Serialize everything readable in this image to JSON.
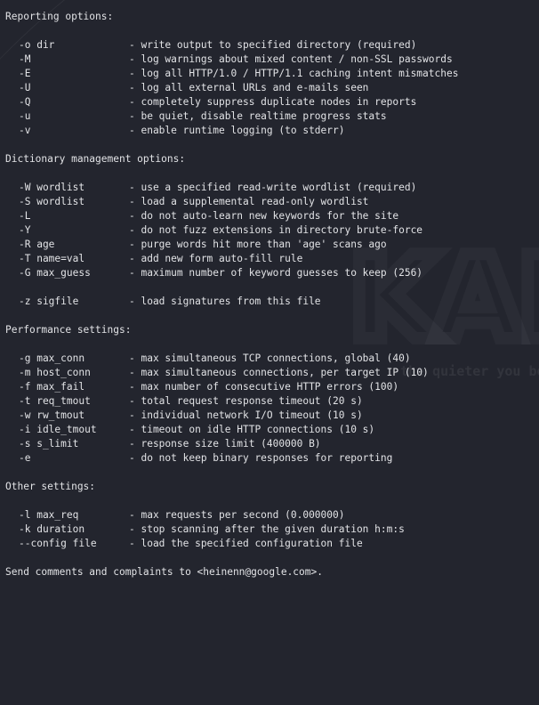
{
  "watermark": {
    "text": "KALI",
    "tagline": "the quieter you become"
  },
  "sections": [
    {
      "title": "Reporting options:",
      "options": [
        {
          "flag": "-o dir",
          "desc": "- write output to specified directory (required)"
        },
        {
          "flag": "-M",
          "desc": "- log warnings about mixed content / non-SSL passwords"
        },
        {
          "flag": "-E",
          "desc": "- log all HTTP/1.0 / HTTP/1.1 caching intent mismatches"
        },
        {
          "flag": "-U",
          "desc": "- log all external URLs and e-mails seen"
        },
        {
          "flag": "-Q",
          "desc": "- completely suppress duplicate nodes in reports"
        },
        {
          "flag": "-u",
          "desc": "- be quiet, disable realtime progress stats"
        },
        {
          "flag": "-v",
          "desc": "- enable runtime logging (to stderr)"
        }
      ]
    },
    {
      "title": "Dictionary management options:",
      "options": [
        {
          "flag": "-W wordlist",
          "desc": "- use a specified read-write wordlist (required)"
        },
        {
          "flag": "-S wordlist",
          "desc": "- load a supplemental read-only wordlist"
        },
        {
          "flag": "-L",
          "desc": "- do not auto-learn new keywords for the site"
        },
        {
          "flag": "-Y",
          "desc": "- do not fuzz extensions in directory brute-force"
        },
        {
          "flag": "-R age",
          "desc": "- purge words hit more than 'age' scans ago"
        },
        {
          "flag": "-T name=val",
          "desc": "- add new form auto-fill rule"
        },
        {
          "flag": "-G max_guess",
          "desc": "- maximum number of keyword guesses to keep (256)"
        },
        {
          "flag": "",
          "desc": ""
        },
        {
          "flag": "-z sigfile",
          "desc": "- load signatures from this file"
        }
      ]
    },
    {
      "title": "Performance settings:",
      "options": [
        {
          "flag": "-g max_conn",
          "desc": "- max simultaneous TCP connections, global (40)"
        },
        {
          "flag": "-m host_conn",
          "desc": "- max simultaneous connections, per target IP (10)"
        },
        {
          "flag": "-f max_fail",
          "desc": "- max number of consecutive HTTP errors (100)"
        },
        {
          "flag": "-t req_tmout",
          "desc": "- total request response timeout (20 s)"
        },
        {
          "flag": "-w rw_tmout",
          "desc": "- individual network I/O timeout (10 s)"
        },
        {
          "flag": "-i idle_tmout",
          "desc": "- timeout on idle HTTP connections (10 s)"
        },
        {
          "flag": "-s s_limit",
          "desc": "- response size limit (400000 B)"
        },
        {
          "flag": "-e",
          "desc": "- do not keep binary responses for reporting"
        }
      ]
    },
    {
      "title": "Other settings:",
      "options": [
        {
          "flag": "-l max_req",
          "desc": "- max requests per second (0.000000)"
        },
        {
          "flag": "-k duration",
          "desc": "- stop scanning after the given duration h:m:s"
        },
        {
          "flag": "--config file",
          "desc": "- load the specified configuration file"
        }
      ]
    }
  ],
  "footer": "Send comments and complaints to <heinenn@google.com>."
}
